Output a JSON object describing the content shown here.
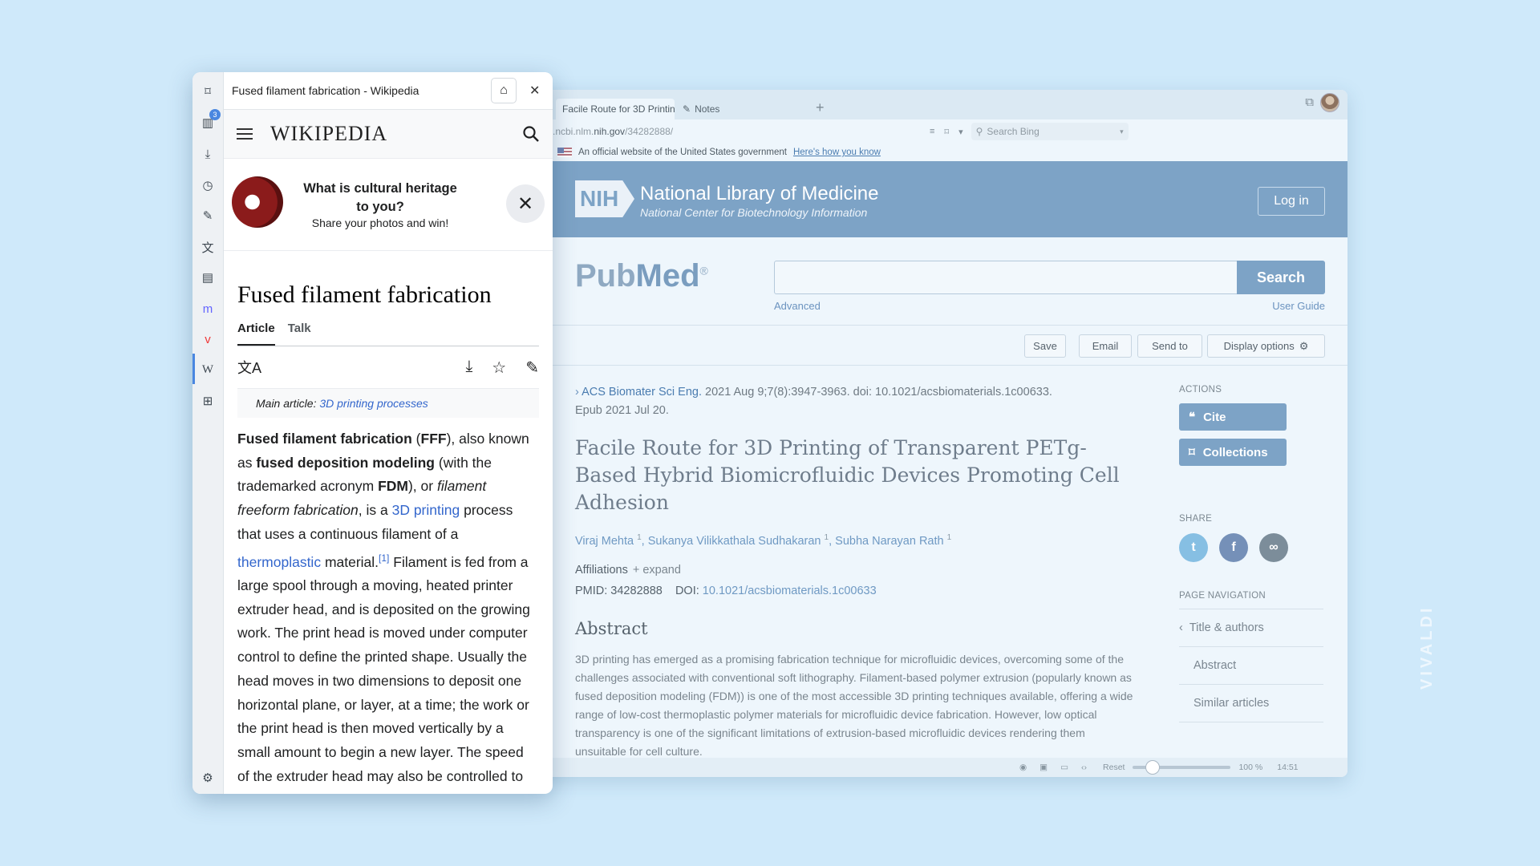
{
  "browser": {
    "tabs": [
      {
        "label": "Facile Route for 3D Printin"
      },
      {
        "label": "Notes"
      }
    ],
    "url_prefix": ".ncbi.nlm.",
    "url_host": "nih.gov",
    "url_path": "/34282888/",
    "search_placeholder": "Search Bing",
    "gov_text": "An official website of the United States government",
    "gov_link": "Here's how you know",
    "status": {
      "reset": "Reset",
      "zoom": "100 %",
      "time": "14:51"
    }
  },
  "nih": {
    "logo": "NIH",
    "title": "National Library of Medicine",
    "subtitle": "National Center for Biotechnology Information",
    "login": "Log in"
  },
  "pubmed": {
    "logo_pub": "Pub",
    "logo_med": "Med",
    "search_btn": "Search",
    "advanced": "Advanced",
    "user_guide": "User Guide",
    "toolbar": {
      "save": "Save",
      "email": "Email",
      "send_to": "Send to",
      "display": "Display options"
    }
  },
  "article": {
    "journal": "ACS Biomater Sci Eng.",
    "citation": " 2021 Aug 9;7(8):3947-3963. doi: 10.1021/acsbiomaterials.1c00633.",
    "epub": "Epub 2021 Jul 20.",
    "title": "Facile Route for 3D Printing of Transparent PETg-Based Hybrid Biomicrofluidic Devices Promoting Cell Adhesion",
    "authors": [
      {
        "name": "Viraj Mehta",
        "sup": "1"
      },
      {
        "name": "Sukanya Vilikkathala Sudhakaran",
        "sup": "1"
      },
      {
        "name": "Subha Narayan Rath",
        "sup": "1"
      }
    ],
    "affiliations": "Affiliations",
    "expand": "+ expand",
    "pmid": "PMID: 34282888",
    "doi_label": "DOI:",
    "doi": "10.1021/acsbiomaterials.1c00633",
    "abstract_heading": "Abstract",
    "abstract": "3D printing has emerged as a promising fabrication technique for microfluidic devices, overcoming some of the challenges associated with conventional soft lithography. Filament-based polymer extrusion (popularly known as fused deposition modeling (FDM)) is one of the most accessible 3D printing techniques available, offering a wide range of low-cost thermoplastic polymer materials for microfluidic device fabrication. However, low optical transparency is one of the significant limitations of extrusion-based microfluidic devices rendering them unsuitable for cell culture."
  },
  "side": {
    "actions": "ACTIONS",
    "cite": "Cite",
    "collections": "Collections",
    "share": "SHARE",
    "page_nav": "PAGE NAVIGATION",
    "nav": [
      "Title & authors",
      "Abstract",
      "Similar articles"
    ]
  },
  "panel": {
    "title": "Fused filament fabrication - Wikipedia",
    "badge": "3",
    "wiki_logo": "WIKIPEDIA",
    "banner_q": "What is cultural heritage to you?",
    "banner_s": "Share your photos and win!",
    "article_title": "Fused filament fabrication",
    "tab_article": "Article",
    "tab_talk": "Talk",
    "hatnote_prefix": "Main article: ",
    "hatnote_link": "3D printing processes",
    "body": {
      "b1": "Fused filament fabrication",
      "t1": " (",
      "b2": "FFF",
      "t2": "), also known as ",
      "b3": "fused deposition modeling",
      "t3": " (with the trademarked acronym ",
      "b4": "FDM",
      "t4": "), or ",
      "i1": "filament freeform fabrication",
      "t5": ", is a ",
      "l1": "3D printing",
      "t6": " process that uses a continuous filament of a ",
      "l2": "thermoplastic",
      "t7": " material.",
      "ref": "[1]",
      "t8": " Filament is fed from a large spool through a moving, heated printer extruder head, and is deposited on the growing work. The print head is moved under computer control to define the printed shape. Usually the head moves in two dimensions to deposit one horizontal plane, or layer, at a time; the work or the print head is then moved vertically by a small amount to begin a new layer. The speed of the extruder head may also be controlled to stop and start deposition"
    }
  },
  "watermark": "VIVALDI",
  "colors": {
    "accent": "#7da3c6",
    "wiki_link": "#3366cc",
    "background": "#cfe9fa"
  }
}
